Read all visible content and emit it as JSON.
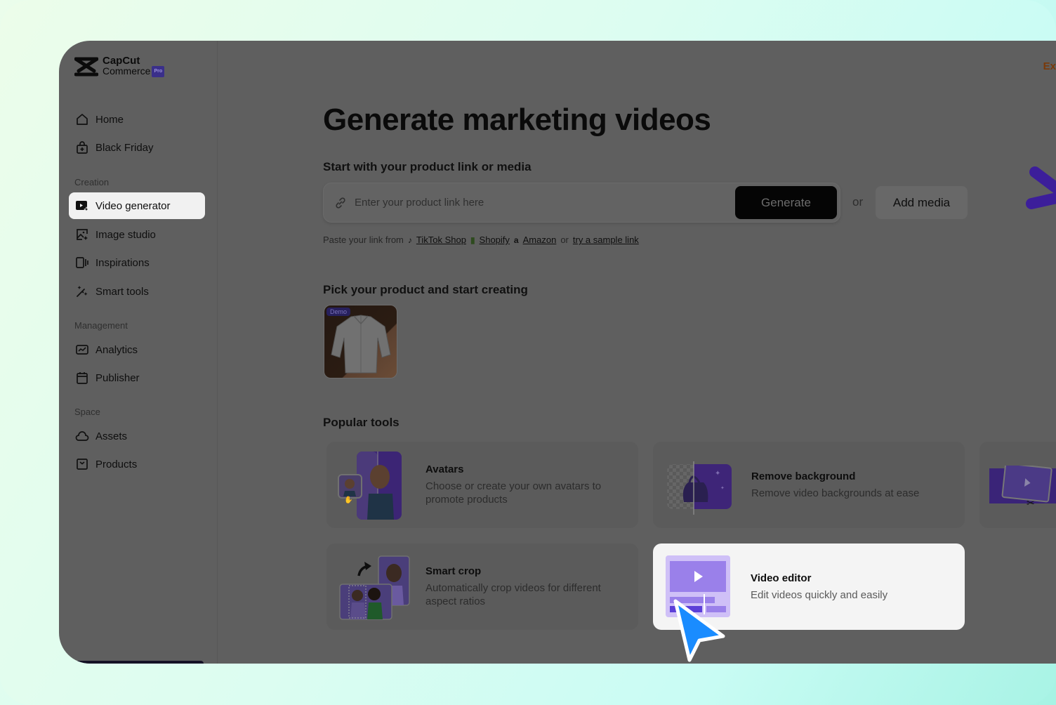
{
  "brand": {
    "name_line1": "CapCut",
    "name_line2": "Commerce",
    "badge": "Pro"
  },
  "sidebar": {
    "top_items": [
      {
        "label": "Home",
        "icon": "home-icon"
      },
      {
        "label": "Black Friday",
        "icon": "shopping-bag-icon"
      }
    ],
    "sections": [
      {
        "title": "Creation",
        "items": [
          {
            "label": "Video generator",
            "icon": "video-sparkle-icon",
            "active": true
          },
          {
            "label": "Image studio",
            "icon": "image-sparkle-icon"
          },
          {
            "label": "Inspirations",
            "icon": "inspirations-icon"
          },
          {
            "label": "Smart tools",
            "icon": "magic-wand-icon"
          }
        ]
      },
      {
        "title": "Management",
        "items": [
          {
            "label": "Analytics",
            "icon": "analytics-icon"
          },
          {
            "label": "Publisher",
            "icon": "calendar-icon"
          }
        ]
      },
      {
        "title": "Space",
        "items": [
          {
            "label": "Assets",
            "icon": "cloud-icon"
          },
          {
            "label": "Products",
            "icon": "box-icon"
          }
        ]
      }
    ]
  },
  "header": {
    "corner_link": "Ex"
  },
  "main": {
    "title": "Generate marketing videos",
    "link_section_title": "Start with your product link or media",
    "link_input": {
      "placeholder": "Enter your product link here",
      "value": ""
    },
    "generate_label": "Generate",
    "or_label": "or",
    "add_media_label": "Add media",
    "sources": {
      "prefix": "Paste your link from",
      "links": [
        "TikTok Shop",
        "Shopify",
        "Amazon"
      ],
      "or_label": "or",
      "sample_link": "try a sample link"
    },
    "product_section_title": "Pick your product and start creating",
    "products": [
      {
        "badge": "Demo",
        "name": "white shirt"
      }
    ],
    "tools_section_title": "Popular tools",
    "tools": [
      {
        "title": "Avatars",
        "description": "Choose or create your own avatars to promote products"
      },
      {
        "title": "Remove background",
        "description": "Remove video backgrounds at ease"
      },
      {
        "title": "Smart crop",
        "description": "Automatically crop videos for different aspect ratios"
      },
      {
        "title": "Video editor",
        "description": "Edit videos quickly and easily",
        "highlighted": true
      }
    ]
  },
  "colors": {
    "accent_purple": "#5b3cc4",
    "cursor_blue": "#1a8cff",
    "overlay_gray": "#5f5f5f"
  }
}
